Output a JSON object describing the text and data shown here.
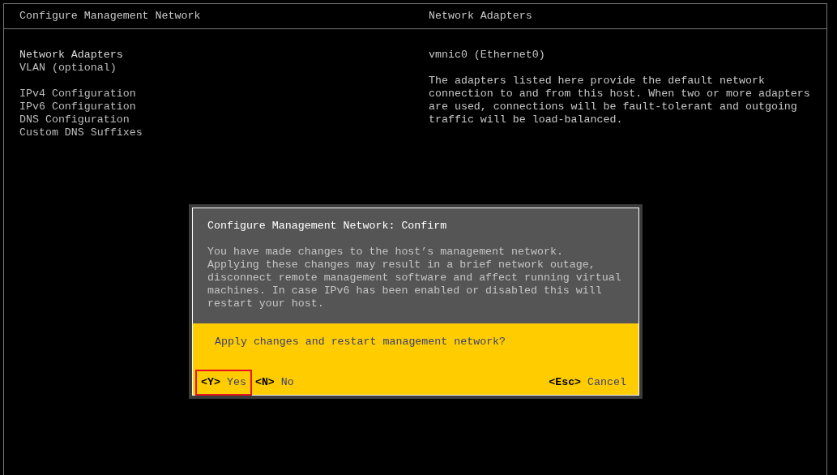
{
  "left_panel": {
    "title": "Configure Management Network",
    "menu_groups": [
      {
        "items": [
          {
            "label": "Network Adapters",
            "selected": true
          },
          {
            "label": "VLAN (optional)",
            "selected": false
          }
        ]
      },
      {
        "items": [
          {
            "label": "IPv4 Configuration",
            "selected": false
          },
          {
            "label": "IPv6 Configuration",
            "selected": false
          },
          {
            "label": "DNS Configuration",
            "selected": false
          },
          {
            "label": "Custom DNS Suffixes",
            "selected": false
          }
        ]
      }
    ]
  },
  "right_panel": {
    "title": "Network Adapters",
    "value": "vmnic0 (Ethernet0)",
    "description": "The adapters listed here provide the default network connection to and from this host. When two or more adapters are used, connections will be fault-tolerant and outgoing traffic will be load-balanced."
  },
  "dialog": {
    "title": "Configure Management Network: Confirm",
    "message": "You have made changes to the host’s management network.\nApplying these changes may result in a brief network outage,\ndisconnect remote management software and affect running virtual\nmachines. In case IPv6 has been enabled or disabled this will\nrestart your host.",
    "question": "Apply changes and restart management network?",
    "left_actions": [
      {
        "key": "<Y>",
        "label": "Yes",
        "annotated": true
      },
      {
        "key": "<N>",
        "label": "No",
        "annotated": false
      }
    ],
    "right_actions": [
      {
        "key": "<Esc>",
        "label": "Cancel",
        "annotated": false
      }
    ]
  }
}
